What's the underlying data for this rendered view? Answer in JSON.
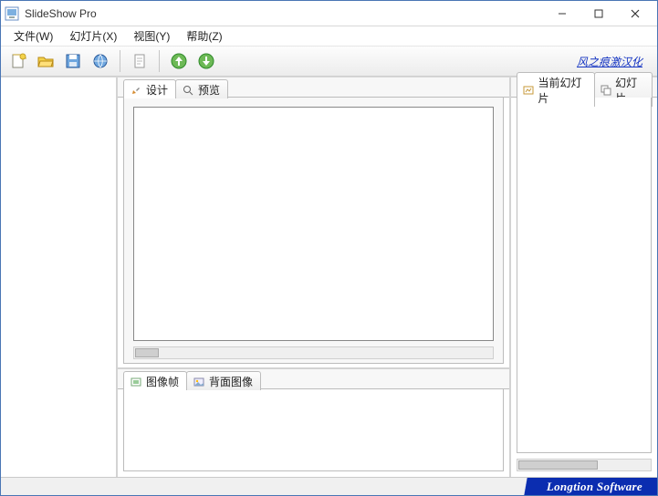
{
  "titlebar": {
    "title": "SlideShow Pro"
  },
  "menu": {
    "file": "文件(W)",
    "slide": "幻灯片(X)",
    "view": "视图(Y)",
    "help": "帮助(Z)"
  },
  "toolbar": {
    "link_text": "风之痕激汉化"
  },
  "tabs": {
    "design": "设计",
    "preview": "预览",
    "current_slide": "当前幻灯片",
    "slides": "幻灯片",
    "image_frames": "图像帧",
    "back_image": "背面图像"
  },
  "status": {
    "vendor": "Longtion Software"
  }
}
